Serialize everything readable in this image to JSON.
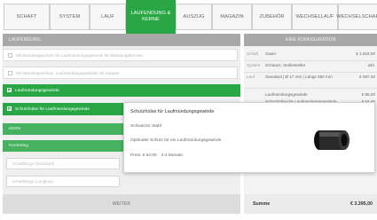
{
  "tabs": [
    {
      "label": "SCHAFT",
      "active": false
    },
    {
      "label": "SYSTEM",
      "active": false
    },
    {
      "label": "LAUF",
      "active": false
    },
    {
      "label": "LAUFENDUNG & KERNE",
      "active": true
    },
    {
      "label": "AUSZUG",
      "active": false
    },
    {
      "label": "MAGAZIN",
      "active": false
    },
    {
      "label": "ZUBEHÖR",
      "active": false
    },
    {
      "label": "WECHSELLAUF",
      "active": false
    },
    {
      "label": "WECHSELSCHAFT",
      "active": false
    }
  ],
  "left_panel": {
    "header": "LAUFENDUNG",
    "options": [
      {
        "label": "Mit Mündungsschutz mit Laufmündungsgewinde für Mündungsbremse",
        "checked": false
      },
      {
        "label": "Mit Mündungsschutz, Laufmündungsgewinde mit Adapter",
        "checked": false
      },
      {
        "label": "Laufmündungsgewinde",
        "checked": true
      },
      {
        "label": "Schutzhülse für Laufmündungsgewinde",
        "checked": true
      }
    ],
    "sub_header": "KERN",
    "kern_selected": "Kernbeleg",
    "kern_inputs": [
      "Schaftlänge (Standard)",
      "Schaftlänge (Langbau)"
    ],
    "next_button": "WEITER"
  },
  "right_panel": {
    "header": "IHRE KONFIGURATION",
    "rows": [
      {
        "k": "Schaft",
        "v": "Sauer",
        "p": "€ 1.816,00"
      },
      {
        "k": "System",
        "v": "Schwarz, Stollenkeller",
        "p": "inkl."
      },
      {
        "k": "Lauf",
        "v": "Standard | Ø 17 mm | Länge 560 mm",
        "p": "€ 597,00"
      },
      {
        "k": "",
        "v": "Laufmündungsgewinde",
        "p": "€ 55,00"
      },
      {
        "k": "",
        "v": "Schutzhülse für Laufmündungsgewinde",
        "p": "€ 54,00"
      }
    ],
    "total_label": "Summe",
    "total_value": "€ 3.395,00"
  },
  "popup": {
    "title": "Schutzhülse für Laufmündungsgewinde",
    "line1": "Schwarzer Stahl",
    "line2": "Optimaler Schutz für ein Laufmündungsgewinde",
    "price": "Preis: € 54,00",
    "delivery": "3-4 Monate"
  },
  "colors": {
    "accent": "#29a745",
    "header_grey": "#a8a8a8"
  }
}
